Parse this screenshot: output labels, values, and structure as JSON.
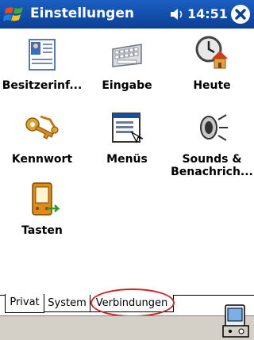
{
  "titlebar": {
    "title": "Einstellungen",
    "time": "14:51",
    "start_icon": "windows-flag-icon",
    "volume_icon": "speaker-icon",
    "close_icon": "close-icon"
  },
  "grid": [
    {
      "label": "Besitzerinf...",
      "icon": "owner-info-icon"
    },
    {
      "label": "Eingabe",
      "icon": "keyboard-icon"
    },
    {
      "label": "Heute",
      "icon": "today-clock-icon"
    },
    {
      "label": "Kennwort",
      "icon": "keys-icon"
    },
    {
      "label": "Menüs",
      "icon": "menu-window-icon"
    },
    {
      "label": "Sounds &\nBenachrich...",
      "icon": "speaker-sound-icon"
    },
    {
      "label": "Tasten",
      "icon": "device-buttons-icon"
    }
  ],
  "tabs": [
    {
      "label": "Privat",
      "active": true
    },
    {
      "label": "System",
      "active": false
    },
    {
      "label": "Verbindungen",
      "active": false
    }
  ],
  "cmdbar": {
    "sip_icon": "input-panel-icon"
  },
  "colors": {
    "titlebar": "#0b3f97",
    "annotation_circle": "#cc2222",
    "cmdbar": "#d4d0c8"
  }
}
